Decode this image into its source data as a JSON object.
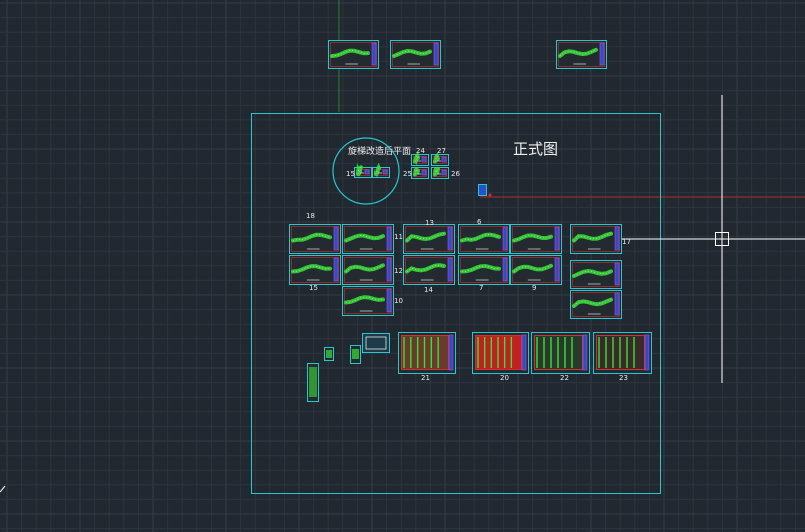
{
  "drawing": {
    "background": "#212830",
    "grid_color": "#2c3440",
    "major_grid_color": "#333c48",
    "frame_color": "#25c7d0",
    "sheet_border_color": "#d03030",
    "drawing_color": "#38e038",
    "crosshair_color": "#ffffff",
    "red_axis_color": "#b03030",
    "green_axis_color": "#2e7d32"
  },
  "labels": {
    "main_title": "正式图",
    "circle_title": "旋梯改造后平面",
    "n_15": "15",
    "n_16": "16",
    "n_24": "24",
    "n_27": "27",
    "n_25": "25",
    "n_26": "26",
    "n_18": "18",
    "n_13": "13",
    "n_6": "6",
    "n_11": "11",
    "n_17": "17",
    "n_12": "12",
    "n_9": "9",
    "n_14": "14",
    "n_7": "7",
    "n_10": "10",
    "n_21": "21",
    "n_20": "20",
    "n_22": "22",
    "n_23": "23",
    "n_15b": "15"
  }
}
